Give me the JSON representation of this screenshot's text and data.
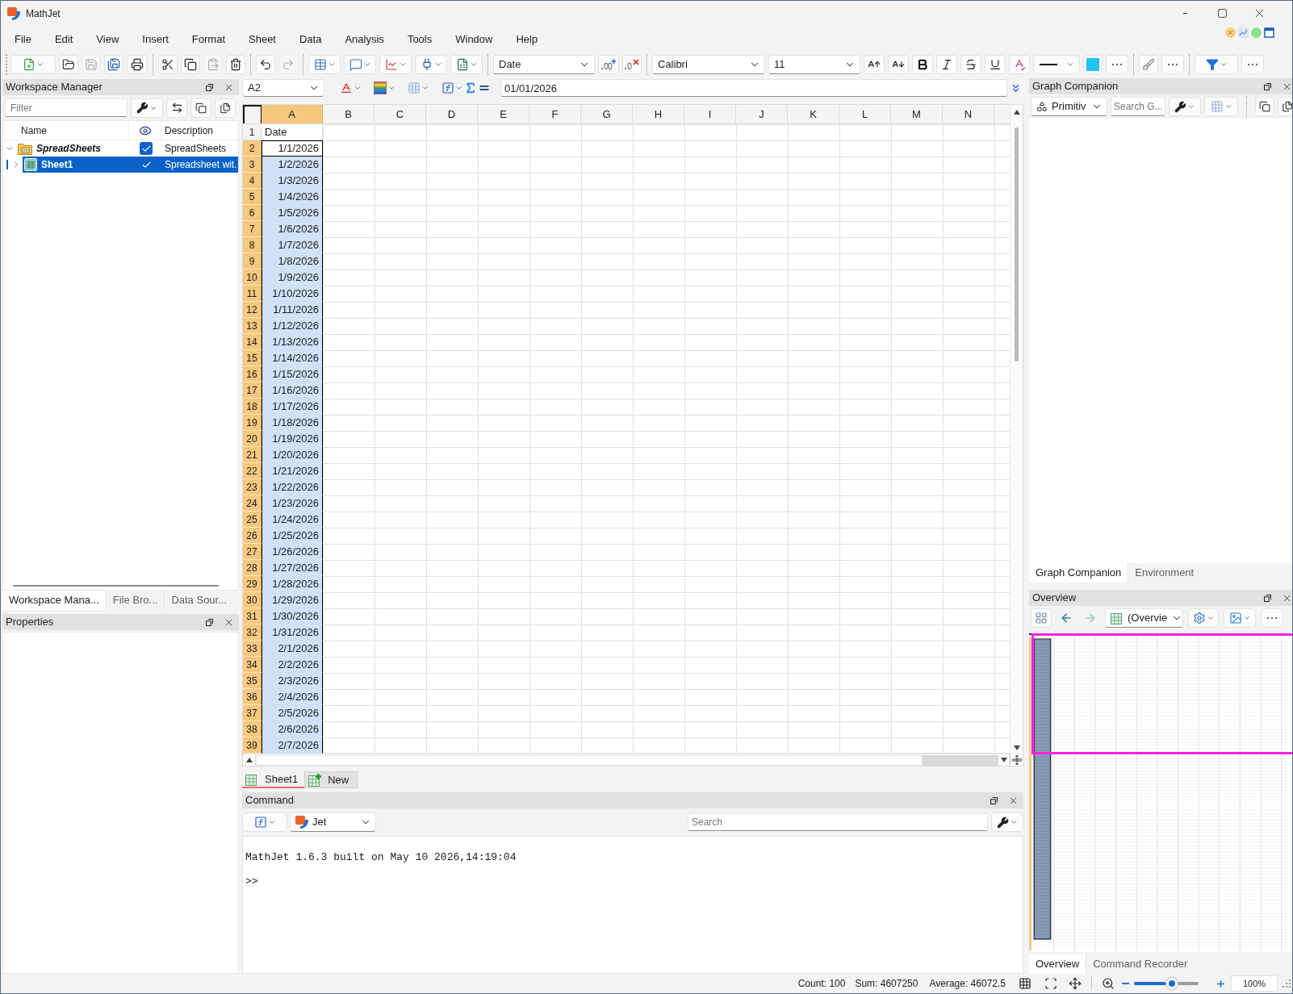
{
  "window": {
    "title": "MathJet"
  },
  "menu": [
    "File",
    "Edit",
    "View",
    "Insert",
    "Format",
    "Sheet",
    "Data",
    "Analysis",
    "Tools",
    "Window",
    "Help"
  ],
  "toolbar": [
    [
      {
        "kind": "new",
        "disabled": false
      },
      {
        "kind": "open",
        "disabled": false
      },
      {
        "kind": "save",
        "disabled": true
      },
      {
        "kind": "save_all",
        "disabled": false
      },
      {
        "kind": "print",
        "disabled": false
      }
    ],
    [
      {
        "kind": "cut",
        "disabled": false
      },
      {
        "kind": "copy",
        "disabled": false
      },
      {
        "kind": "paste",
        "disabled": true
      },
      {
        "kind": "delete",
        "disabled": false
      }
    ],
    [
      {
        "kind": "undo",
        "disabled": false
      },
      {
        "kind": "redo",
        "disabled": true
      }
    ],
    [
      {
        "kind": "table",
        "disabled": false
      },
      {
        "kind": "comment",
        "disabled": false
      },
      {
        "kind": "chart",
        "disabled": false
      },
      {
        "kind": "plugin",
        "disabled": false
      },
      {
        "kind": "formula_sheet",
        "disabled": false
      }
    ],
    [
      {
        "kind": "number_format",
        "value": "Date",
        "disabled": false
      },
      {
        "kind": "add_decimal",
        "disabled": false
      },
      {
        "kind": "remove_decimal",
        "disabled": false
      }
    ],
    [
      {
        "kind": "font",
        "value": "Calibri",
        "disabled": false
      },
      {
        "kind": "font_size",
        "value": "11",
        "disabled": false
      },
      {
        "kind": "grow_font",
        "disabled": false
      },
      {
        "kind": "shrink_font",
        "disabled": false
      },
      {
        "kind": "bold",
        "disabled": false
      },
      {
        "kind": "italic",
        "disabled": false
      },
      {
        "kind": "strike",
        "disabled": false
      },
      {
        "kind": "underline",
        "disabled": false
      },
      {
        "kind": "spell",
        "disabled": false
      },
      {
        "kind": "line_style",
        "disabled": false
      },
      {
        "kind": "fill_color",
        "disabled": false
      },
      {
        "kind": "more",
        "disabled": false
      }
    ],
    [
      {
        "kind": "clear_format",
        "disabled": false
      },
      {
        "kind": "more",
        "disabled": false
      }
    ],
    [
      {
        "kind": "filter",
        "disabled": false
      },
      {
        "kind": "more",
        "disabled": false
      }
    ]
  ],
  "workspace_manager": {
    "title": "Workspace Manager",
    "filter": {
      "placeholder": "Filter"
    },
    "name_column": "Name",
    "description_column": "Description",
    "tree": [
      {
        "kind": "folder",
        "name": "SpreadSheets",
        "description": "SpreadSheets",
        "visible": true,
        "expanded": true,
        "selected": false,
        "children": [
          {
            "kind": "sheet",
            "name": "Sheet1",
            "description": "Spreadsheet wit.",
            "visible": true,
            "expanded": false,
            "selected": true
          }
        ]
      }
    ],
    "tabs": [
      {
        "label": "Workspace Mana...",
        "selected": true
      },
      {
        "label": "File Bro...",
        "selected": false
      },
      {
        "label": "Data Sour...",
        "selected": false
      }
    ]
  },
  "properties": {
    "title": "Properties"
  },
  "formula_bar": {
    "cell_ref": "A2",
    "value": "01/01/2026"
  },
  "sheet": {
    "columns": [
      {
        "label": "A",
        "selected": true
      },
      {
        "label": "B",
        "selected": false
      },
      {
        "label": "C",
        "selected": false
      },
      {
        "label": "D",
        "selected": false
      },
      {
        "label": "E",
        "selected": false
      },
      {
        "label": "F",
        "selected": false
      },
      {
        "label": "G",
        "selected": false
      },
      {
        "label": "H",
        "selected": false
      },
      {
        "label": "I",
        "selected": false
      },
      {
        "label": "J",
        "selected": false
      },
      {
        "label": "K",
        "selected": false
      },
      {
        "label": "L",
        "selected": false
      },
      {
        "label": "M",
        "selected": false
      },
      {
        "label": "N",
        "selected": false
      }
    ],
    "rows": [
      {
        "header": "1",
        "kind": "text",
        "value": "Date",
        "selected": false,
        "active": false
      },
      {
        "header": "2",
        "kind": "date",
        "value": "1/1/2026",
        "selected": true,
        "active": true
      },
      {
        "header": "3",
        "kind": "date",
        "value": "1/2/2026",
        "selected": true,
        "active": false
      },
      {
        "header": "4",
        "kind": "date",
        "value": "1/3/2026",
        "selected": true,
        "active": false
      },
      {
        "header": "5",
        "kind": "date",
        "value": "1/4/2026",
        "selected": true,
        "active": false
      },
      {
        "header": "6",
        "kind": "date",
        "value": "1/5/2026",
        "selected": true,
        "active": false
      },
      {
        "header": "7",
        "kind": "date",
        "value": "1/6/2026",
        "selected": true,
        "active": false
      },
      {
        "header": "8",
        "kind": "date",
        "value": "1/7/2026",
        "selected": true,
        "active": false
      },
      {
        "header": "9",
        "kind": "date",
        "value": "1/8/2026",
        "selected": true,
        "active": false
      },
      {
        "header": "10",
        "kind": "date",
        "value": "1/9/2026",
        "selected": true,
        "active": false
      },
      {
        "header": "11",
        "kind": "date",
        "value": "1/10/2026",
        "selected": true,
        "active": false
      },
      {
        "header": "12",
        "kind": "date",
        "value": "1/11/2026",
        "selected": true,
        "active": false
      },
      {
        "header": "13",
        "kind": "date",
        "value": "1/12/2026",
        "selected": true,
        "active": false
      },
      {
        "header": "14",
        "kind": "date",
        "value": "1/13/2026",
        "selected": true,
        "active": false
      },
      {
        "header": "15",
        "kind": "date",
        "value": "1/14/2026",
        "selected": true,
        "active": false
      },
      {
        "header": "16",
        "kind": "date",
        "value": "1/15/2026",
        "selected": true,
        "active": false
      },
      {
        "header": "17",
        "kind": "date",
        "value": "1/16/2026",
        "selected": true,
        "active": false
      },
      {
        "header": "18",
        "kind": "date",
        "value": "1/17/2026",
        "selected": true,
        "active": false
      },
      {
        "header": "19",
        "kind": "date",
        "value": "1/18/2026",
        "selected": true,
        "active": false
      },
      {
        "header": "20",
        "kind": "date",
        "value": "1/19/2026",
        "selected": true,
        "active": false
      },
      {
        "header": "21",
        "kind": "date",
        "value": "1/20/2026",
        "selected": true,
        "active": false
      },
      {
        "header": "22",
        "kind": "date",
        "value": "1/21/2026",
        "selected": true,
        "active": false
      },
      {
        "header": "23",
        "kind": "date",
        "value": "1/22/2026",
        "selected": true,
        "active": false
      },
      {
        "header": "24",
        "kind": "date",
        "value": "1/23/2026",
        "selected": true,
        "active": false
      },
      {
        "header": "25",
        "kind": "date",
        "value": "1/24/2026",
        "selected": true,
        "active": false
      },
      {
        "header": "26",
        "kind": "date",
        "value": "1/25/2026",
        "selected": true,
        "active": false
      },
      {
        "header": "27",
        "kind": "date",
        "value": "1/26/2026",
        "selected": true,
        "active": false
      },
      {
        "header": "28",
        "kind": "date",
        "value": "1/27/2026",
        "selected": true,
        "active": false
      },
      {
        "header": "29",
        "kind": "date",
        "value": "1/28/2026",
        "selected": true,
        "active": false
      },
      {
        "header": "30",
        "kind": "date",
        "value": "1/29/2026",
        "selected": true,
        "active": false
      },
      {
        "header": "31",
        "kind": "date",
        "value": "1/30/2026",
        "selected": true,
        "active": false
      },
      {
        "header": "32",
        "kind": "date",
        "value": "1/31/2026",
        "selected": true,
        "active": false
      },
      {
        "header": "33",
        "kind": "date",
        "value": "2/1/2026",
        "selected": true,
        "active": false
      },
      {
        "header": "34",
        "kind": "date",
        "value": "2/2/2026",
        "selected": true,
        "active": false
      },
      {
        "header": "35",
        "kind": "date",
        "value": "2/3/2026",
        "selected": true,
        "active": false
      },
      {
        "header": "36",
        "kind": "date",
        "value": "2/4/2026",
        "selected": true,
        "active": false
      },
      {
        "header": "37",
        "kind": "date",
        "value": "2/5/2026",
        "selected": true,
        "active": false
      },
      {
        "header": "38",
        "kind": "date",
        "value": "2/6/2026",
        "selected": true,
        "active": false
      },
      {
        "header": "39",
        "kind": "date",
        "value": "2/7/2026",
        "selected": true,
        "active": false
      }
    ],
    "tabs": [
      {
        "kind": "sheet",
        "label": "Sheet1",
        "selected": true
      },
      {
        "kind": "new",
        "label": "New",
        "selected": false
      }
    ]
  },
  "command": {
    "title": "Command",
    "interpreter": "Jet",
    "search": {
      "placeholder": "Search"
    },
    "output": [
      "MathJet 1.6.3 built on May 10 2026,14:19:04",
      ">>"
    ]
  },
  "graph_companion": {
    "title": "Graph Companion",
    "mode": "Primitiv",
    "search": {
      "placeholder": "Search G..."
    },
    "tabs": [
      {
        "label": "Graph Companion",
        "selected": true
      },
      {
        "label": "Environment",
        "selected": false
      }
    ]
  },
  "overview": {
    "title": "Overview",
    "nav": [
      {
        "kind": "back",
        "disabled": false
      },
      {
        "kind": "forward",
        "disabled": true
      }
    ],
    "view": "(Overvie",
    "tabs": [
      {
        "label": "Overview",
        "selected": true
      },
      {
        "label": "Command Recorder",
        "selected": false
      }
    ]
  },
  "status_bar": {
    "count": "Count: 100",
    "sum": "Sum: 4607250",
    "average": "Average: 46072.5",
    "zoom": {
      "level": 0.5,
      "reading": "100%"
    }
  }
}
